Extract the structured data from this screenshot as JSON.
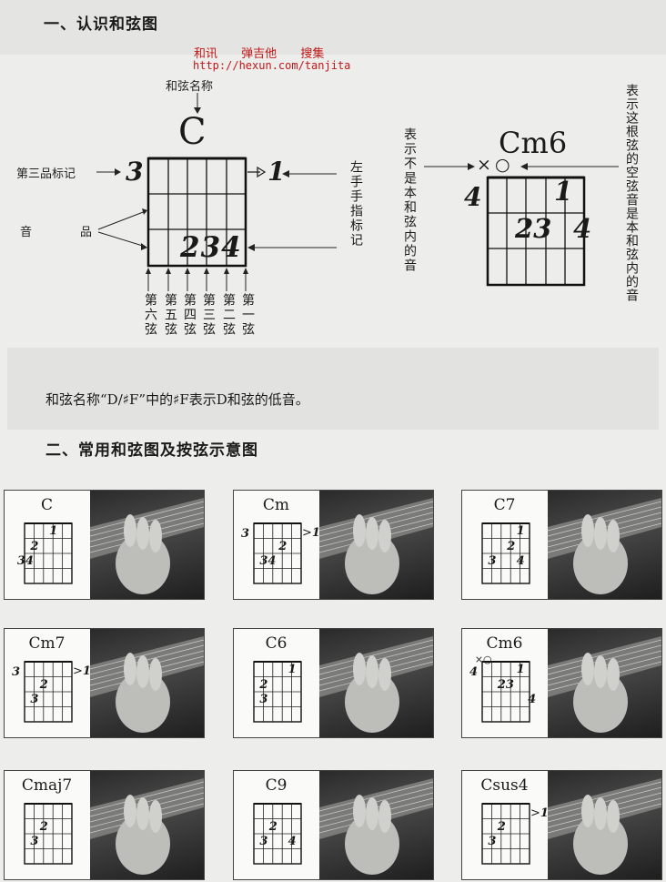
{
  "section1_title": "一、认识和弦图",
  "watermark": {
    "line1": [
      "和讯",
      "弹吉他",
      "搜集"
    ],
    "url": "http://hexun.com/tanjita"
  },
  "diagram_main": {
    "chord_name": "C",
    "label_chord_name": "和弦名称",
    "label_fret_marker": "第三品标记",
    "fret_number": "3",
    "label_sound": "音",
    "label_fret": "品",
    "label_left_fingers": "左手手指标记",
    "finger_right": "1",
    "fingers_row": "234",
    "strings": [
      "第六弦",
      "第五弦",
      "第四弦",
      "第三弦",
      "第二弦",
      "第一弦"
    ]
  },
  "diagram_cm6": {
    "label_not_chord": "表示不是本和弦内的音",
    "label_open_string": "表示这根弦的空弦音是本和弦内的音",
    "chord_name": "Cm6",
    "symbol_x": "×",
    "symbol_o": "○",
    "fret_number": "4",
    "finger_1": "1",
    "finger_23": "23",
    "finger_4": "4"
  },
  "note": "和弦名称“D/♯F”中的♯F表示D和弦的低音。",
  "section2_title": "二、常用和弦图及按弦示意图",
  "cards": [
    {
      "name": "C",
      "fret": "",
      "arrow": "",
      "marks": [
        "1",
        "2",
        "34"
      ]
    },
    {
      "name": "Cm",
      "fret": "3",
      "arrow": "1",
      "marks": [
        "2",
        "34"
      ]
    },
    {
      "name": "C7",
      "fret": "",
      "arrow": "",
      "marks": [
        "1",
        "2",
        "3",
        "4"
      ]
    },
    {
      "name": "Cm7",
      "fret": "3",
      "arrow": "1",
      "marks": [
        "2",
        "3"
      ]
    },
    {
      "name": "C6",
      "fret": "",
      "arrow": "",
      "marks": [
        "1",
        "2",
        "3"
      ]
    },
    {
      "name": "Cm6",
      "fret": "4",
      "arrow": "",
      "marks": [
        "1",
        "23",
        "4",
        "×○"
      ]
    },
    {
      "name": "Cmaj7",
      "fret": "",
      "arrow": "",
      "marks": [
        "2",
        "3"
      ]
    },
    {
      "name": "C9",
      "fret": "",
      "arrow": "",
      "marks": [
        "2",
        "3",
        "4"
      ]
    },
    {
      "name": "Csus4",
      "fret": "",
      "arrow": "1",
      "marks": [
        "2",
        "3"
      ]
    }
  ]
}
